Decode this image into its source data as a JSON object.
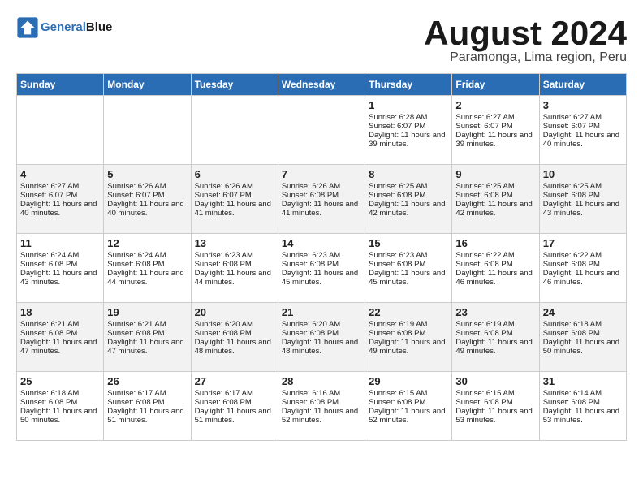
{
  "header": {
    "logo_general": "General",
    "logo_blue": "Blue",
    "month": "August 2024",
    "location": "Paramonga, Lima region, Peru"
  },
  "days_of_week": [
    "Sunday",
    "Monday",
    "Tuesday",
    "Wednesday",
    "Thursday",
    "Friday",
    "Saturday"
  ],
  "weeks": [
    [
      {
        "day": "",
        "info": ""
      },
      {
        "day": "",
        "info": ""
      },
      {
        "day": "",
        "info": ""
      },
      {
        "day": "",
        "info": ""
      },
      {
        "day": "1",
        "info": "Sunrise: 6:28 AM\nSunset: 6:07 PM\nDaylight: 11 hours and 39 minutes."
      },
      {
        "day": "2",
        "info": "Sunrise: 6:27 AM\nSunset: 6:07 PM\nDaylight: 11 hours and 39 minutes."
      },
      {
        "day": "3",
        "info": "Sunrise: 6:27 AM\nSunset: 6:07 PM\nDaylight: 11 hours and 40 minutes."
      }
    ],
    [
      {
        "day": "4",
        "info": "Sunrise: 6:27 AM\nSunset: 6:07 PM\nDaylight: 11 hours and 40 minutes."
      },
      {
        "day": "5",
        "info": "Sunrise: 6:26 AM\nSunset: 6:07 PM\nDaylight: 11 hours and 40 minutes."
      },
      {
        "day": "6",
        "info": "Sunrise: 6:26 AM\nSunset: 6:07 PM\nDaylight: 11 hours and 41 minutes."
      },
      {
        "day": "7",
        "info": "Sunrise: 6:26 AM\nSunset: 6:08 PM\nDaylight: 11 hours and 41 minutes."
      },
      {
        "day": "8",
        "info": "Sunrise: 6:25 AM\nSunset: 6:08 PM\nDaylight: 11 hours and 42 minutes."
      },
      {
        "day": "9",
        "info": "Sunrise: 6:25 AM\nSunset: 6:08 PM\nDaylight: 11 hours and 42 minutes."
      },
      {
        "day": "10",
        "info": "Sunrise: 6:25 AM\nSunset: 6:08 PM\nDaylight: 11 hours and 43 minutes."
      }
    ],
    [
      {
        "day": "11",
        "info": "Sunrise: 6:24 AM\nSunset: 6:08 PM\nDaylight: 11 hours and 43 minutes."
      },
      {
        "day": "12",
        "info": "Sunrise: 6:24 AM\nSunset: 6:08 PM\nDaylight: 11 hours and 44 minutes."
      },
      {
        "day": "13",
        "info": "Sunrise: 6:23 AM\nSunset: 6:08 PM\nDaylight: 11 hours and 44 minutes."
      },
      {
        "day": "14",
        "info": "Sunrise: 6:23 AM\nSunset: 6:08 PM\nDaylight: 11 hours and 45 minutes."
      },
      {
        "day": "15",
        "info": "Sunrise: 6:23 AM\nSunset: 6:08 PM\nDaylight: 11 hours and 45 minutes."
      },
      {
        "day": "16",
        "info": "Sunrise: 6:22 AM\nSunset: 6:08 PM\nDaylight: 11 hours and 46 minutes."
      },
      {
        "day": "17",
        "info": "Sunrise: 6:22 AM\nSunset: 6:08 PM\nDaylight: 11 hours and 46 minutes."
      }
    ],
    [
      {
        "day": "18",
        "info": "Sunrise: 6:21 AM\nSunset: 6:08 PM\nDaylight: 11 hours and 47 minutes."
      },
      {
        "day": "19",
        "info": "Sunrise: 6:21 AM\nSunset: 6:08 PM\nDaylight: 11 hours and 47 minutes."
      },
      {
        "day": "20",
        "info": "Sunrise: 6:20 AM\nSunset: 6:08 PM\nDaylight: 11 hours and 48 minutes."
      },
      {
        "day": "21",
        "info": "Sunrise: 6:20 AM\nSunset: 6:08 PM\nDaylight: 11 hours and 48 minutes."
      },
      {
        "day": "22",
        "info": "Sunrise: 6:19 AM\nSunset: 6:08 PM\nDaylight: 11 hours and 49 minutes."
      },
      {
        "day": "23",
        "info": "Sunrise: 6:19 AM\nSunset: 6:08 PM\nDaylight: 11 hours and 49 minutes."
      },
      {
        "day": "24",
        "info": "Sunrise: 6:18 AM\nSunset: 6:08 PM\nDaylight: 11 hours and 50 minutes."
      }
    ],
    [
      {
        "day": "25",
        "info": "Sunrise: 6:18 AM\nSunset: 6:08 PM\nDaylight: 11 hours and 50 minutes."
      },
      {
        "day": "26",
        "info": "Sunrise: 6:17 AM\nSunset: 6:08 PM\nDaylight: 11 hours and 51 minutes."
      },
      {
        "day": "27",
        "info": "Sunrise: 6:17 AM\nSunset: 6:08 PM\nDaylight: 11 hours and 51 minutes."
      },
      {
        "day": "28",
        "info": "Sunrise: 6:16 AM\nSunset: 6:08 PM\nDaylight: 11 hours and 52 minutes."
      },
      {
        "day": "29",
        "info": "Sunrise: 6:15 AM\nSunset: 6:08 PM\nDaylight: 11 hours and 52 minutes."
      },
      {
        "day": "30",
        "info": "Sunrise: 6:15 AM\nSunset: 6:08 PM\nDaylight: 11 hours and 53 minutes."
      },
      {
        "day": "31",
        "info": "Sunrise: 6:14 AM\nSunset: 6:08 PM\nDaylight: 11 hours and 53 minutes."
      }
    ]
  ]
}
